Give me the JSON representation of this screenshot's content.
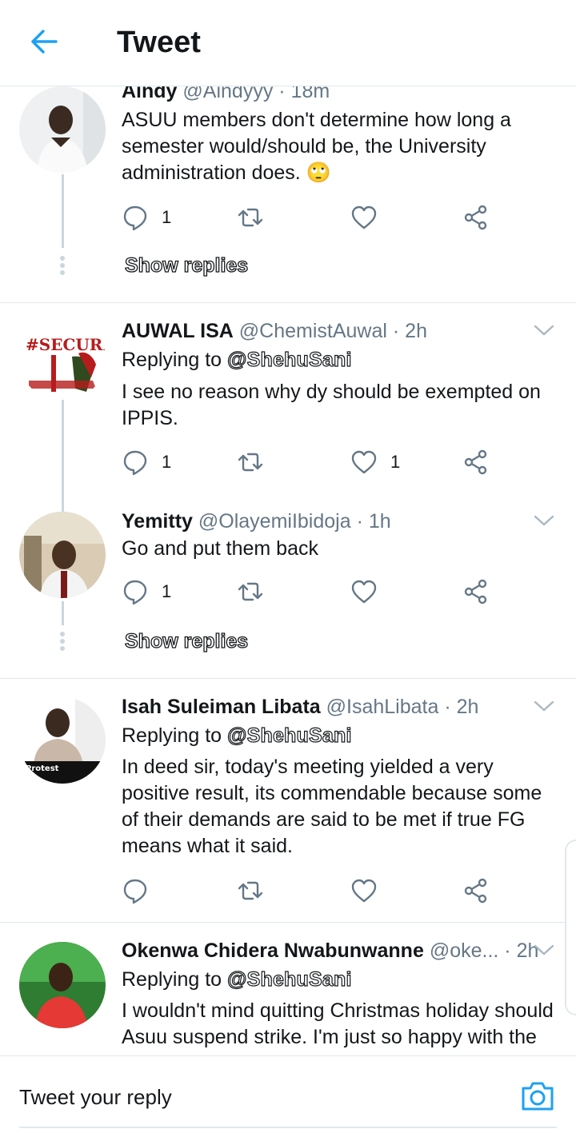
{
  "header": {
    "title": "Tweet"
  },
  "tweets": [
    {
      "name": "Aindy",
      "handle": "@Aindyyy",
      "sep": "·",
      "time": "18m",
      "text": "ASUU members don't determine how long a semester would/should be, the University administration does. 🙄",
      "replies": "1",
      "likes": "",
      "show_replies": "Show replies"
    },
    {
      "name": "AUWAL ISA",
      "handle": "@ChemistAuwal",
      "sep": "·",
      "time": "2h",
      "replying_label": "Replying to",
      "replying_to": "@ShehuSani",
      "text": "I see no reason why dy should be exempted on IPPIS.",
      "replies": "1",
      "likes": "1",
      "avatar_text": "#SECURE NORTH"
    },
    {
      "name": "Yemitty",
      "handle": "@OlayemiIbidoja",
      "sep": "·",
      "time": "1h",
      "text": "Go and put them back",
      "replies": "1",
      "likes": "",
      "show_replies": "Show replies"
    },
    {
      "name": "Isah Suleiman Libata",
      "handle": "@IsahLibata",
      "sep": "·",
      "time": "2h",
      "replying_label": "Replying to",
      "replying_to": "@ShehuSani",
      "text": "In deed sir, today's meeting yielded a very positive result, its commendable because some of their demands are said to be met if true FG means what it said.",
      "replies": "",
      "likes": "",
      "avatar_text": "Protest"
    },
    {
      "name": "Okenwa Chidera Nwabunwanne",
      "handle": "@oke...",
      "sep": "·",
      "time": "2h",
      "replying_label": "Replying to",
      "replying_to": "@ShehuSani",
      "text": "I wouldn't mind quitting Christmas holiday should Asuu suspend strike. I'm just so happy with the"
    }
  ],
  "reply_bar": {
    "placeholder": "Tweet your reply"
  },
  "colors": {
    "accent": "#1da1f2",
    "icon_gray": "#657786",
    "divider": "#e1e8ed"
  }
}
